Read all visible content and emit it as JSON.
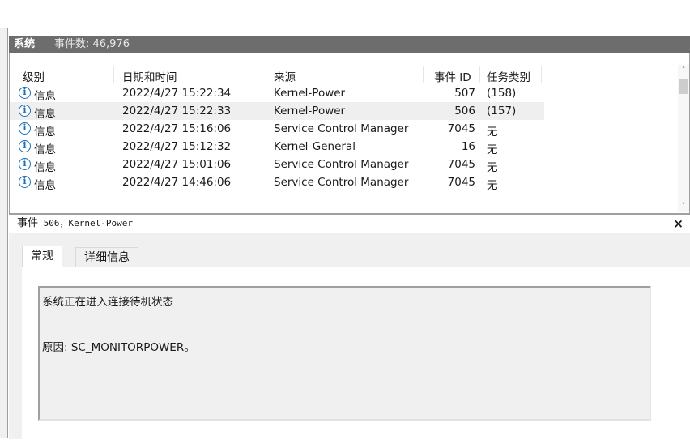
{
  "panel": {
    "name": "系统",
    "count_label": "事件数: 46,976"
  },
  "columns": [
    "级别",
    "日期和时间",
    "来源",
    "事件 ID",
    "任务类别"
  ],
  "rows": [
    {
      "level": "信息",
      "datetime": "2022/4/27 15:22:34",
      "source": "Kernel-Power",
      "id": "507",
      "task": "(158)",
      "icon": "info-icon"
    },
    {
      "level": "信息",
      "datetime": "2022/4/27 15:22:33",
      "source": "Kernel-Power",
      "id": "506",
      "task": "(157)",
      "icon": "info-icon"
    },
    {
      "level": "信息",
      "datetime": "2022/4/27 15:16:06",
      "source": "Service Control Manager",
      "id": "7045",
      "task": "无",
      "icon": "info-icon"
    },
    {
      "level": "信息",
      "datetime": "2022/4/27 15:12:32",
      "source": "Kernel-General",
      "id": "16",
      "task": "无",
      "icon": "info-icon"
    },
    {
      "level": "信息",
      "datetime": "2022/4/27 15:01:06",
      "source": "Service Control Manager",
      "id": "7045",
      "task": "无",
      "icon": "info-icon"
    },
    {
      "level": "信息",
      "datetime": "2022/4/27 14:46:06",
      "source": "Service Control Manager",
      "id": "7045",
      "task": "无",
      "icon": "info-icon"
    }
  ],
  "detail": {
    "title_prefix": "事件",
    "title_mono": " 506，Kernel-Power",
    "close": "×",
    "tabs": [
      "常规",
      "详细信息"
    ],
    "message_line1": "系统正在进入连接待机状态",
    "message_line2": "原因: SC_MONITORPOWER。"
  },
  "scroll": {
    "up": "˄",
    "down": "˅"
  }
}
